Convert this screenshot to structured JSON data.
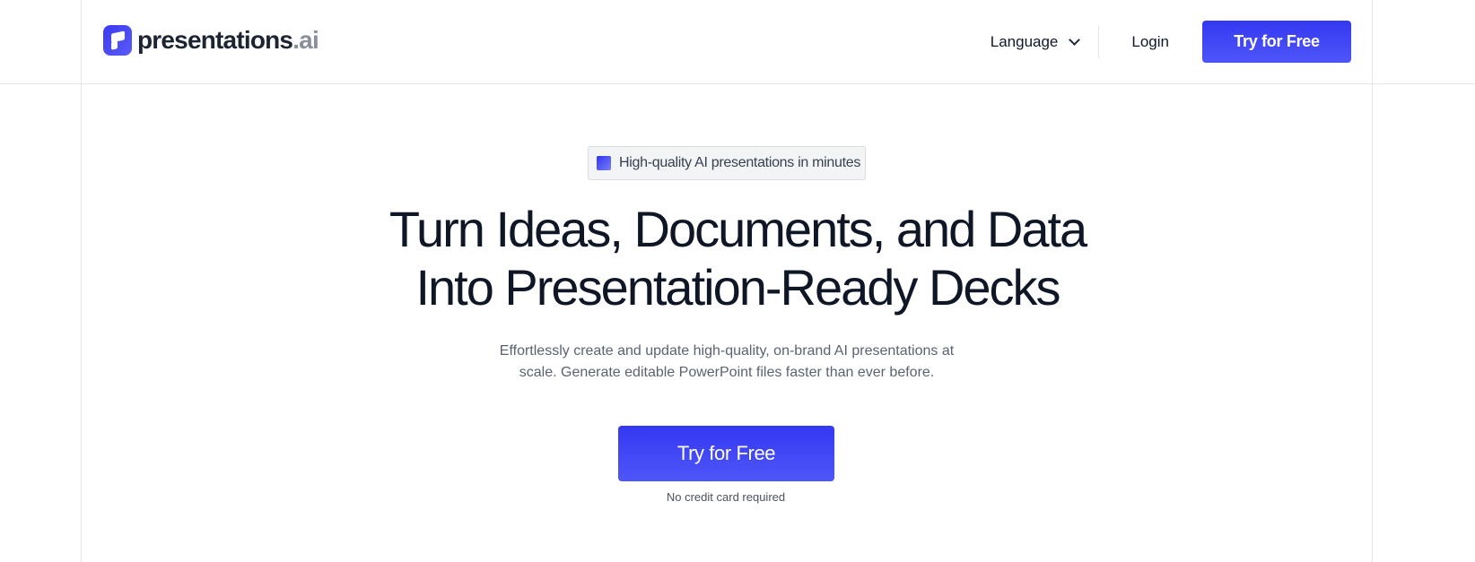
{
  "header": {
    "logo_text": "presentations",
    "logo_suffix": ".ai",
    "language_label": "Language",
    "login_label": "Login",
    "cta_label": "Try for Free"
  },
  "hero": {
    "badge_text": "High-quality AI presentations in minutes",
    "headline_line1": "Turn Ideas, Documents, and Data",
    "headline_line2": "Into Presentation-Ready Decks",
    "subtitle": "Effortlessly create and update high-quality, on-brand AI presentations at scale. Generate editable PowerPoint files faster than ever before.",
    "cta_label": "Try for Free",
    "cta_note": "No credit card required"
  },
  "colors": {
    "accent": "#3b40f5",
    "text": "#0f172a",
    "muted": "#5b6270"
  },
  "icons": {
    "logo": "presentations-logo-icon",
    "language": "chevron-down-icon",
    "badge": "gradient-square-icon"
  }
}
